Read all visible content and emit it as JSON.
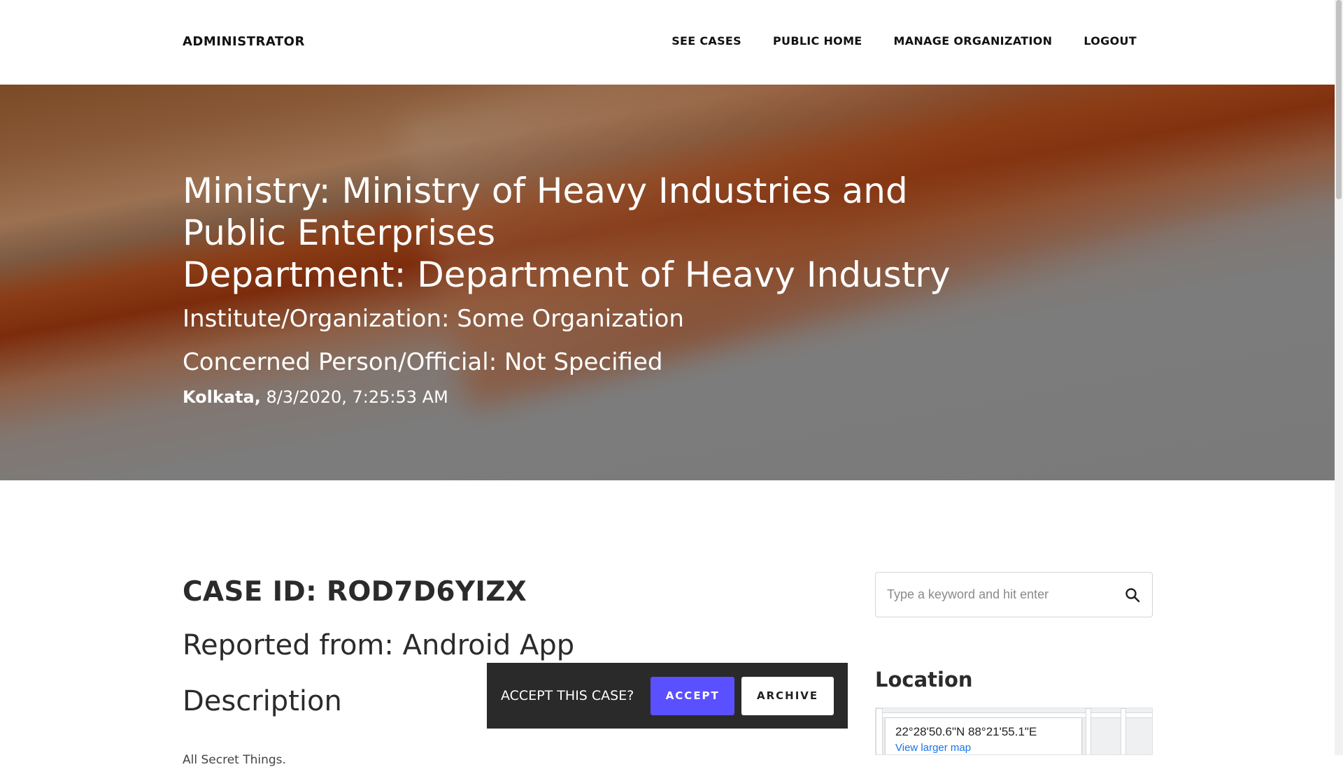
{
  "nav": {
    "brand": "ADMINISTRATOR",
    "links": [
      "SEE CASES",
      "PUBLIC HOME",
      "MANAGE ORGANIZATION",
      "LOGOUT"
    ]
  },
  "hero": {
    "ministry_line": "Ministry: Ministry of Heavy Industries and Public Enterprises",
    "department_line": "Department: Department of Heavy Industry",
    "institute_line": "Institute/Organization: Some Organization",
    "person_line": "Concerned Person/Official: Not Specified",
    "city": "Kolkata,",
    "datetime": "8/3/2020, 7:25:53 AM"
  },
  "case": {
    "id_line": "CASE ID: ROD7D6YIZX",
    "reported_line": "Reported from: Android App",
    "description_heading": "Description",
    "description_text": "All Secret Things."
  },
  "sidebar": {
    "search_placeholder": "Type a keyword and hit enter",
    "location_heading": "Location",
    "map_coords": "22°28'50.6\"N 88°21'55.1\"E",
    "map_link": "View larger map"
  },
  "accept_prompt": {
    "question": "ACCEPT THIS CASE?",
    "accept_label": "ACCEPT",
    "archive_label": "ARCHIVE"
  },
  "colors": {
    "accent": "#5b50ff",
    "prompt_bg": "#2a2a2a",
    "link_blue": "#1a73e8"
  }
}
